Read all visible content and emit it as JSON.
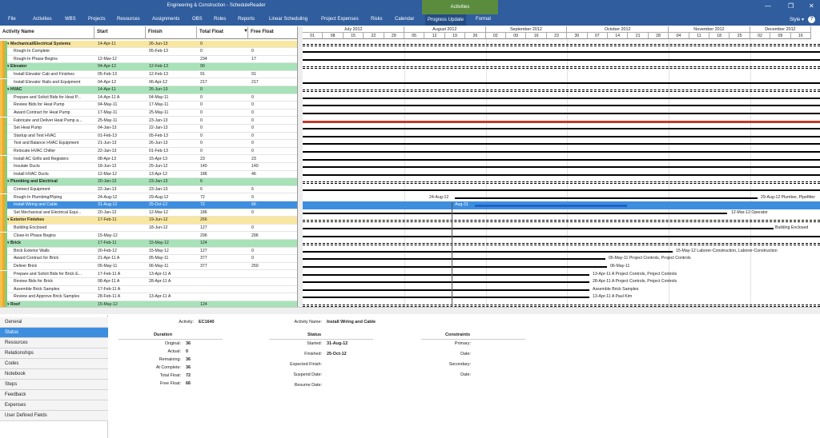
{
  "window": {
    "title": "Engineering & Construction - ScheduleReader",
    "context_tab": "Activities",
    "min": "—",
    "max": "❐",
    "close": "✕"
  },
  "menu": [
    "File",
    "Activities",
    "WBS",
    "Projects",
    "Resources",
    "Assignments",
    "OBS",
    "Roles",
    "Reports",
    "Linear Scheduling",
    "Project Expenses",
    "Risks",
    "Calendar",
    "Progress Update",
    "Format"
  ],
  "menu_active": "Progress Update",
  "style_label": "Style",
  "help": "?",
  "columns": {
    "name": "Activity Name",
    "start": "Start",
    "finish": "Finish",
    "total_float": "Total Float",
    "free_float": "Free Float"
  },
  "rows": [
    {
      "g": 1,
      "c": "#f9e7a0",
      "n": "Mechanical/Electrical Systems",
      "s": "14-Apr-11",
      "f": "26-Jun-13",
      "tf": "0",
      "ff": ""
    },
    {
      "n": "Rough-In Complete",
      "s": "",
      "f": "05-Feb-13",
      "tf": "0",
      "ff": "0"
    },
    {
      "n": "Rough-In Phase Begins",
      "s": "12-Mar-12",
      "f": "",
      "tf": "234",
      "ff": "17"
    },
    {
      "g": 1,
      "c": "#a8e2b8",
      "n": "Elevator",
      "s": "04-Apr-12",
      "f": "12-Feb-13",
      "tf": "90",
      "ff": ""
    },
    {
      "n": "Install Elevator Cab and Finishes",
      "s": "05-Feb-13",
      "f": "12-Feb-13",
      "tf": "91",
      "ff": "91"
    },
    {
      "n": "Install Elevator Rails and Equipment",
      "s": "04-Apr-12",
      "f": "06-Apr-12",
      "tf": "217",
      "ff": "217"
    },
    {
      "g": 1,
      "c": "#a8e2b8",
      "n": "HVAC",
      "s": "14-Apr-11",
      "f": "26-Jun-13",
      "tf": "0",
      "ff": ""
    },
    {
      "n": "Prepare and Solicit Bids for Heat P...",
      "s": "14-Apr-11 A",
      "f": "04-May-11",
      "tf": "0",
      "ff": "0"
    },
    {
      "n": "Review Bids for Heat Pump",
      "s": "04-May-11",
      "f": "17-May-11",
      "tf": "0",
      "ff": "0"
    },
    {
      "n": "Award Contract for Heat Pump",
      "s": "17-May-11",
      "f": "25-May-11",
      "tf": "0",
      "ff": "0"
    },
    {
      "n": "Fabricate and Deliver Heat Pump a...",
      "s": "25-May-11",
      "f": "23-Jan-13",
      "tf": "0",
      "ff": "0"
    },
    {
      "n": "Set Heat Pump",
      "s": "04-Jan-13",
      "f": "22-Jan-13",
      "tf": "0",
      "ff": "0"
    },
    {
      "n": "Startup and Test HVAC",
      "s": "01-Feb-13",
      "f": "05-Feb-13",
      "tf": "0",
      "ff": "0"
    },
    {
      "n": "Test and Balance HVAC Equipment",
      "s": "21-Jun-13",
      "f": "26-Jun-13",
      "tf": "0",
      "ff": "0"
    },
    {
      "n": "Relocate HVAC Chiller",
      "s": "22-Jan-13",
      "f": "01-Feb-13",
      "tf": "0",
      "ff": "0"
    },
    {
      "n": "Install AC Grills and Registers",
      "s": "08-Apr-13",
      "f": "15-Apr-13",
      "tf": "23",
      "ff": "23"
    },
    {
      "n": "Insulate Ducts",
      "s": "18-Jun-12",
      "f": "25-Jun-12",
      "tf": "140",
      "ff": "140"
    },
    {
      "n": "Install HVAC Ducts",
      "s": "12-Mar-12",
      "f": "13-Apr-12",
      "tf": "186",
      "ff": "46"
    },
    {
      "g": 1,
      "c": "#a8e2b8",
      "n": "Plumbing and Electrical",
      "s": "20-Jan-12",
      "f": "23-Jan-13",
      "tf": "6",
      "ff": ""
    },
    {
      "n": "Connect Equipment",
      "s": "22-Jan-13",
      "f": "23-Jan-13",
      "tf": "6",
      "ff": "6"
    },
    {
      "n": "Rough-In Plumbing/Piping",
      "s": "24-Aug-12",
      "f": "29-Aug-12",
      "tf": "72",
      "ff": "0"
    },
    {
      "sel": 1,
      "n": "Install Wiring and Cable",
      "s": "31-Aug-12",
      "f": "25-Oct-12",
      "tf": "72",
      "ff": "66"
    },
    {
      "n": "Set Mechanical and Electrical Equi...",
      "s": "20-Jan-12",
      "f": "12-Mar-12",
      "tf": "186",
      "ff": "0"
    },
    {
      "g": 1,
      "c": "#f9e7a0",
      "n": "Exterior Finishes",
      "s": "17-Feb-11",
      "f": "19-Jun-12",
      "tf": "266",
      "ff": ""
    },
    {
      "n": "Building Enclosed",
      "s": "",
      "f": "18-Jun-12",
      "tf": "127",
      "ff": "0"
    },
    {
      "n": "Close-In Phase Begins",
      "s": "15-May-12",
      "f": "",
      "tf": "296",
      "ff": "296"
    },
    {
      "g": 1,
      "c": "#a8e2b8",
      "n": "Brick",
      "s": "17-Feb-11",
      "f": "15-May-12",
      "tf": "124",
      "ff": ""
    },
    {
      "n": "Brick Exterior Walls",
      "s": "20-Feb-12",
      "f": "15-May-12",
      "tf": "127",
      "ff": "0"
    },
    {
      "n": "Award Contract for Brick",
      "s": "21-Apr-11 A",
      "f": "05-May-11",
      "tf": "377",
      "ff": "0"
    },
    {
      "n": "Deliver Brick",
      "s": "05-May-11",
      "f": "06-May-11",
      "tf": "377",
      "ff": "250"
    },
    {
      "n": "Prepare and Solicit Bids for Brick E...",
      "s": "17-Feb-11 A",
      "f": "13-Apr-11 A",
      "tf": "",
      "ff": ""
    },
    {
      "n": "Review Bids for Brick",
      "s": "08-Apr-11 A",
      "f": "28-Apr-11 A",
      "tf": "",
      "ff": ""
    },
    {
      "n": "Assemble Brick Samples",
      "s": "17-Feb-11 A",
      "f": "",
      "tf": "",
      "ff": ""
    },
    {
      "n": "Review and Approve Brick Samples",
      "s": "28-Feb-11 A",
      "f": "13-Apr-11 A",
      "tf": "",
      "ff": ""
    },
    {
      "g": 1,
      "c": "#a8e2b8",
      "n": "Roof",
      "s": "15-May-12",
      "f": "",
      "tf": "124",
      "ff": ""
    }
  ],
  "timescale": {
    "months": [
      "July 2012",
      "August 2012",
      "September 2012",
      "October 2012",
      "November 2012",
      "December 2012"
    ],
    "days": [
      "01",
      "08",
      "15",
      "22",
      "29",
      "05",
      "12",
      "19",
      "26",
      "02",
      "09",
      "16",
      "23",
      "30",
      "07",
      "14",
      "21",
      "28",
      "04",
      "11",
      "18",
      "25",
      "02",
      "09",
      "16"
    ]
  },
  "gantt_labels": {
    "rough_in_left": "24-Aug-12",
    "rough_in_right": "29-Aug-12   Plumber, Pipefitter",
    "sel_left": "Aug-31",
    "set_mech": "12-Mar-12   Operator",
    "building_enclosed": "Building Enclosed",
    "brick_walls": "15-May-12   Laborer-Construction, Laborer-Construction",
    "award_brick": "05-May-11   Project Controls, Project Controls",
    "deliver_brick": "06-May-11",
    "prepare_bids": "13-Apr-11 A   Project Controls, Project Controls",
    "review_bids": "28-Apr-11 A   Project Controls, Project Controls",
    "assemble": "Assemble Brick Samples",
    "review_approve": "13-Apr-11 A   Paul Kim"
  },
  "tabs": [
    "General",
    "Status",
    "Resources",
    "Relationships",
    "Codes",
    "Notebook",
    "Steps",
    "Feedback",
    "Expenses",
    "User Defined Fields"
  ],
  "tab_active": "Status",
  "detail": {
    "activity_label": "Activity:",
    "activity_id": "EC1640",
    "activity_name_label": "Activity Name:",
    "activity_name": "Install Wiring and Cable",
    "duration": {
      "title": "Duration",
      "original_l": "Original:",
      "original": "36",
      "actual_l": "Actual:",
      "actual": "0",
      "remaining_l": "Remaining:",
      "remaining": "36",
      "at_complete_l": "At Complete:",
      "at_complete": "36",
      "total_float_l": "Total Float:",
      "total_float": "72",
      "free_float_l": "Free Float:",
      "free_float": "66"
    },
    "status": {
      "title": "Status",
      "started_l": "Started:",
      "started": "31-Aug-12",
      "finished_l": "Finished:",
      "finished": "25-Oct-12",
      "expected_l": "Expected Finish:",
      "suspend_l": "Suspend Date:",
      "resume_l": "Resume Date:"
    },
    "constraints": {
      "title": "Constraints",
      "primary_l": "Primary:",
      "date1_l": "Date:",
      "secondary_l": "Secondary:",
      "date2_l": "Date:"
    }
  },
  "colors": {
    "titlebar": "#2f5d9e",
    "context": "#5b8c3e",
    "selection": "#3e8ee0",
    "wbs_yellow": "#f9e7a0",
    "wbs_green": "#a8e2b8",
    "critical": "#c0392b"
  }
}
